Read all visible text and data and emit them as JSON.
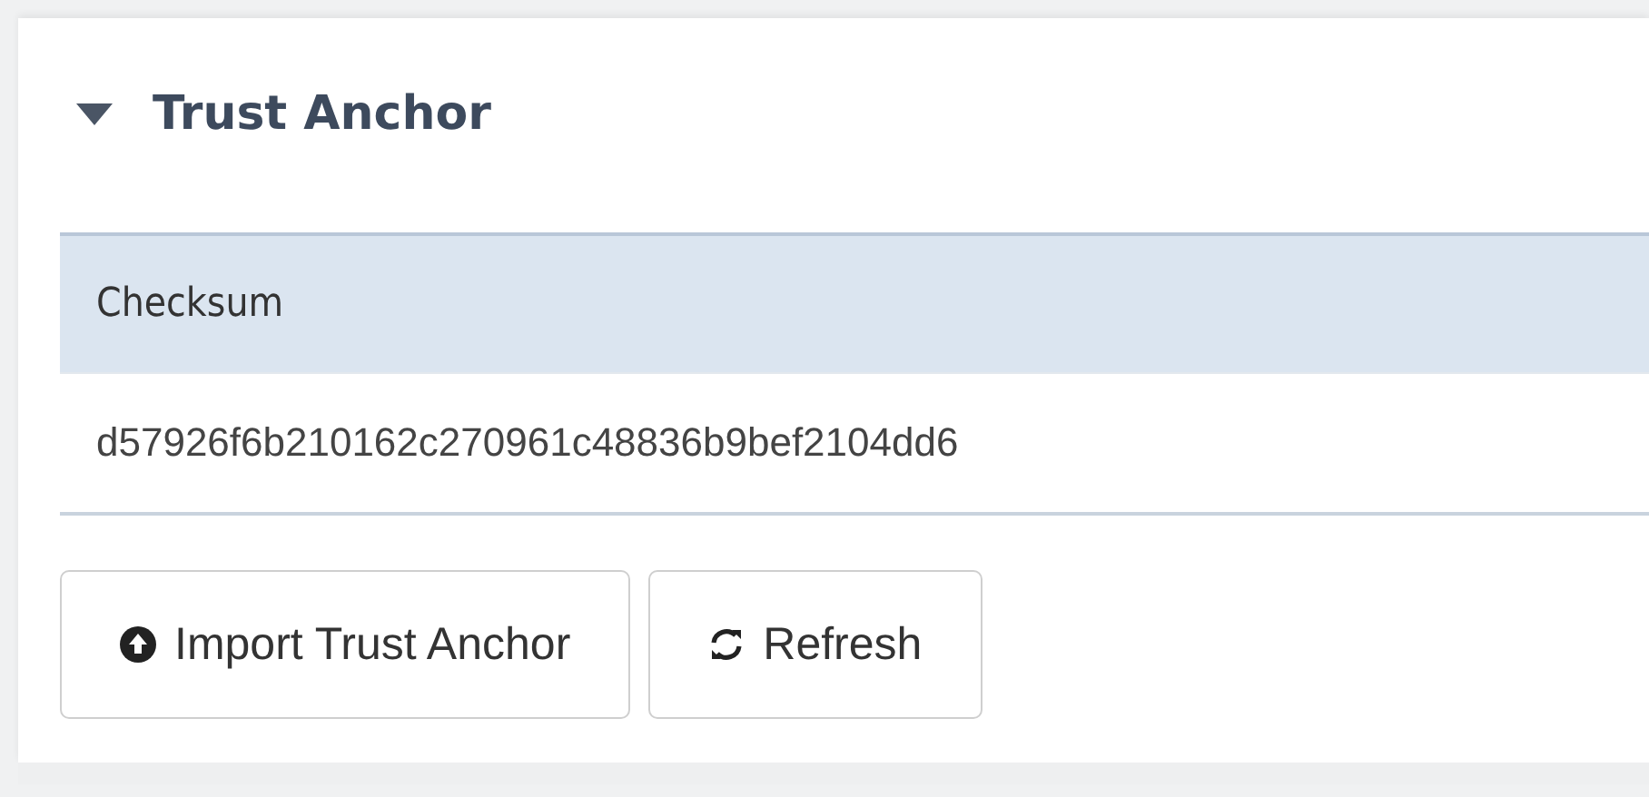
{
  "section": {
    "title": "Trust Anchor",
    "expanded": true
  },
  "table": {
    "columns": [
      "Checksum"
    ],
    "rows": [
      [
        "d57926f6b210162c270961c48836b9bef2104dd6"
      ]
    ]
  },
  "buttons": [
    {
      "label": "Import Trust Anchor",
      "kind": "upload"
    },
    {
      "label": "Refresh",
      "kind": "refresh"
    }
  ]
}
